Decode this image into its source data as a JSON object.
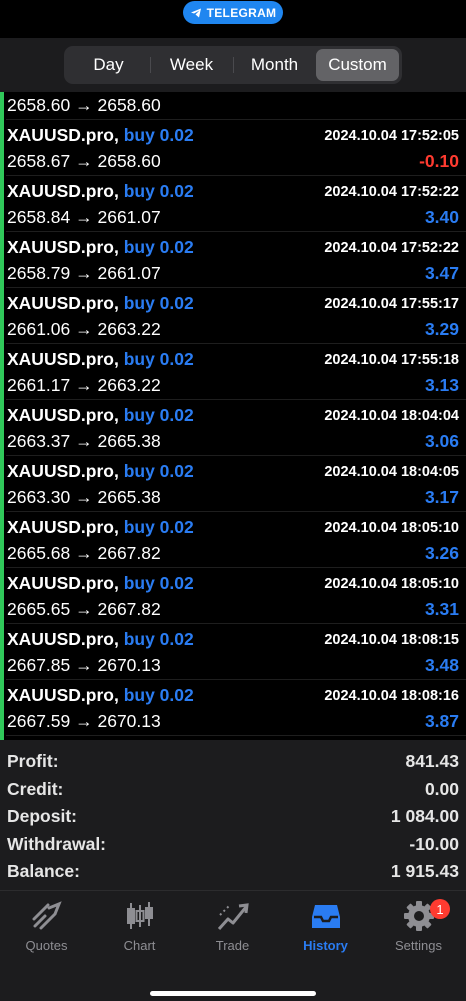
{
  "banner": {
    "label": "TELEGRAM"
  },
  "period_tabs": [
    {
      "label": "Day",
      "active": false
    },
    {
      "label": "Week",
      "active": false
    },
    {
      "label": "Month",
      "active": false
    },
    {
      "label": "Custom",
      "active": true
    }
  ],
  "partial_row": {
    "prices": "2658.60 → 2658.60"
  },
  "deals": [
    {
      "symbol": "XAUUSD.pro,",
      "side": "buy 0.02",
      "time": "2024.10.04 17:52:05",
      "prices": "2658.67 → 2658.60",
      "profit": "-0.10",
      "negative": true
    },
    {
      "symbol": "XAUUSD.pro,",
      "side": "buy 0.02",
      "time": "2024.10.04 17:52:22",
      "prices": "2658.84 → 2661.07",
      "profit": "3.40",
      "negative": false
    },
    {
      "symbol": "XAUUSD.pro,",
      "side": "buy 0.02",
      "time": "2024.10.04 17:52:22",
      "prices": "2658.79 → 2661.07",
      "profit": "3.47",
      "negative": false
    },
    {
      "symbol": "XAUUSD.pro,",
      "side": "buy 0.02",
      "time": "2024.10.04 17:55:17",
      "prices": "2661.06 → 2663.22",
      "profit": "3.29",
      "negative": false
    },
    {
      "symbol": "XAUUSD.pro,",
      "side": "buy 0.02",
      "time": "2024.10.04 17:55:18",
      "prices": "2661.17 → 2663.22",
      "profit": "3.13",
      "negative": false
    },
    {
      "symbol": "XAUUSD.pro,",
      "side": "buy 0.02",
      "time": "2024.10.04 18:04:04",
      "prices": "2663.37 → 2665.38",
      "profit": "3.06",
      "negative": false
    },
    {
      "symbol": "XAUUSD.pro,",
      "side": "buy 0.02",
      "time": "2024.10.04 18:04:05",
      "prices": "2663.30 → 2665.38",
      "profit": "3.17",
      "negative": false
    },
    {
      "symbol": "XAUUSD.pro,",
      "side": "buy 0.02",
      "time": "2024.10.04 18:05:10",
      "prices": "2665.68 → 2667.82",
      "profit": "3.26",
      "negative": false
    },
    {
      "symbol": "XAUUSD.pro,",
      "side": "buy 0.02",
      "time": "2024.10.04 18:05:10",
      "prices": "2665.65 → 2667.82",
      "profit": "3.31",
      "negative": false
    },
    {
      "symbol": "XAUUSD.pro,",
      "side": "buy 0.02",
      "time": "2024.10.04 18:08:15",
      "prices": "2667.85 → 2670.13",
      "profit": "3.48",
      "negative": false
    },
    {
      "symbol": "XAUUSD.pro,",
      "side": "buy 0.02",
      "time": "2024.10.04 18:08:16",
      "prices": "2667.59 → 2670.13",
      "profit": "3.87",
      "negative": false
    }
  ],
  "totals": [
    {
      "label": "Profit:",
      "value": "841.43"
    },
    {
      "label": "Credit:",
      "value": "0.00"
    },
    {
      "label": "Deposit:",
      "value": "1 084.00"
    },
    {
      "label": "Withdrawal:",
      "value": "-10.00"
    },
    {
      "label": "Balance:",
      "value": "1 915.43"
    }
  ],
  "tabs": [
    {
      "label": "Quotes",
      "icon": "quotes-icon",
      "active": false
    },
    {
      "label": "Chart",
      "icon": "candlestick-chart-icon",
      "active": false
    },
    {
      "label": "Trade",
      "icon": "trade-line-icon",
      "active": false
    },
    {
      "label": "History",
      "icon": "history-inbox-icon",
      "active": true
    },
    {
      "label": "Settings",
      "icon": "gear-icon",
      "active": false,
      "badge": "1"
    }
  ],
  "colors": {
    "positive": "#2a7cf2",
    "negative": "#ff3b30",
    "accent": "#2a7cf2",
    "telegram": "#1f86f0",
    "open_marker": "#30c85a"
  }
}
